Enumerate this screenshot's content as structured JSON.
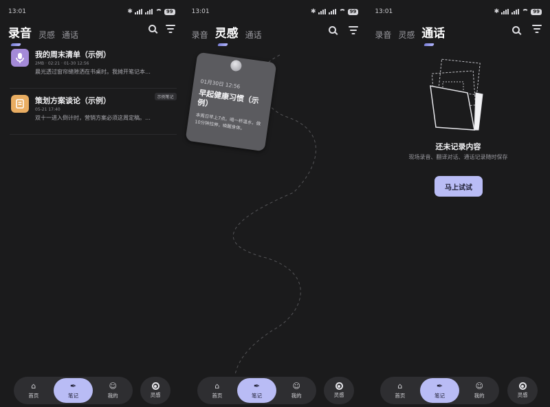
{
  "screens": [
    {
      "time": "13:01",
      "battery": "99",
      "tabs": [
        "录音",
        "灵感",
        "通话"
      ],
      "active_tab": "录音",
      "items": [
        {
          "title": "我的周末清单（示例）",
          "meta": "2MB · 02:21 · 01-30 12:56",
          "desc": "晨光透过窗帘缝隙洒在书桌时。我摊开笔记本…",
          "icon": "mic-app-icon",
          "color": "#a48ad8"
        },
        {
          "title": "策划方案谈论（示例）",
          "meta": "05-21 17:40",
          "desc": "双十一进入倒计时，营销方案必须这周定稿。…",
          "icon": "doc-app-icon",
          "color": "#e9ad62",
          "badge": "示例笔记"
        }
      ]
    },
    {
      "time": "13:01",
      "battery": "99",
      "tabs": [
        "录音",
        "灵感",
        "通话"
      ],
      "active_tab": "灵感",
      "note": {
        "date": "01月30日 12:56",
        "title": "早起健康习惯（示例）",
        "body": "本周日早上7点。喝一杯温水，做10分钟拉伸，唤醒身体。"
      }
    },
    {
      "time": "13:01",
      "battery": "99",
      "tabs": [
        "录音",
        "灵感",
        "通话"
      ],
      "active_tab": "通话",
      "empty": {
        "title": "还未记录内容",
        "subtitle": "现场录音、翻译对话、通话记录随时保存",
        "button": "马上试试"
      }
    }
  ],
  "nav": {
    "items": [
      "首页",
      "笔记",
      "我的"
    ],
    "active": "笔记",
    "side": "灵感"
  },
  "colors": {
    "accent": "#b9bcf5",
    "bg": "#1b1b1c",
    "pill": "#2e2e31"
  }
}
